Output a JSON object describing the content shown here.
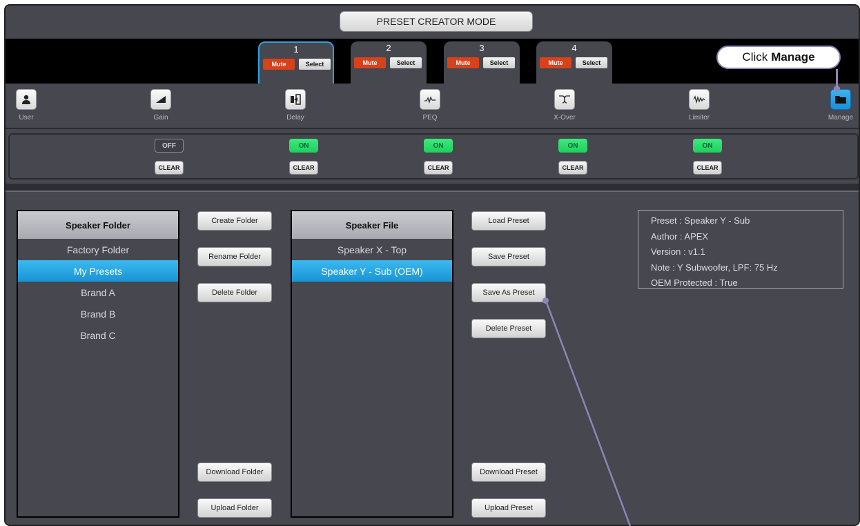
{
  "title": "PRESET CREATOR MODE",
  "channels": [
    {
      "number": "1",
      "mute": "Mute",
      "select": "Select"
    },
    {
      "number": "2",
      "mute": "Mute",
      "select": "Select"
    },
    {
      "number": "3",
      "mute": "Mute",
      "select": "Select"
    },
    {
      "number": "4",
      "mute": "Mute",
      "select": "Select"
    }
  ],
  "toolbar": {
    "user": "User",
    "gain": "Gain",
    "delay": "Delay",
    "peq": "PEQ",
    "xover": "X-Over",
    "limiter": "Limiter",
    "manage": "Manage"
  },
  "toggles": {
    "gain": "OFF",
    "delay": "ON",
    "peq": "ON",
    "xover": "ON",
    "limiter": "ON",
    "clear": "CLEAR"
  },
  "folder_list": {
    "header": "Speaker Folder",
    "items": [
      "Factory Folder",
      "My Presets",
      "Brand A",
      "Brand B",
      "Brand C"
    ],
    "selected": "My Presets"
  },
  "folder_buttons": {
    "create": "Create Folder",
    "rename": "Rename Folder",
    "delete": "Delete Folder",
    "download": "Download Folder",
    "upload": "Upload Folder"
  },
  "file_list": {
    "header": "Speaker File",
    "items": [
      "Speaker X - Top",
      "Speaker Y - Sub (OEM)"
    ],
    "selected": "Speaker Y - Sub (OEM)"
  },
  "preset_buttons": {
    "load": "Load Preset",
    "save": "Save Preset",
    "save_as": "Save As Preset",
    "delete": "Delete Preset",
    "download": "Download Preset",
    "upload": "Upload Preset"
  },
  "preset_info": {
    "preset": "Preset : Speaker Y - Sub",
    "author": "Author : APEX",
    "version": "Version : v1.1",
    "note": "Note : Y Subwoofer, LPF: 75 Hz",
    "oem": "OEM Protected : True"
  },
  "callout": {
    "prefix": "Click",
    "target": "Manage"
  },
  "colors": {
    "accent": "#1c8fd6",
    "mute": "#d9411b",
    "on": "#1fcf5e",
    "callout": "#8b86b8"
  }
}
